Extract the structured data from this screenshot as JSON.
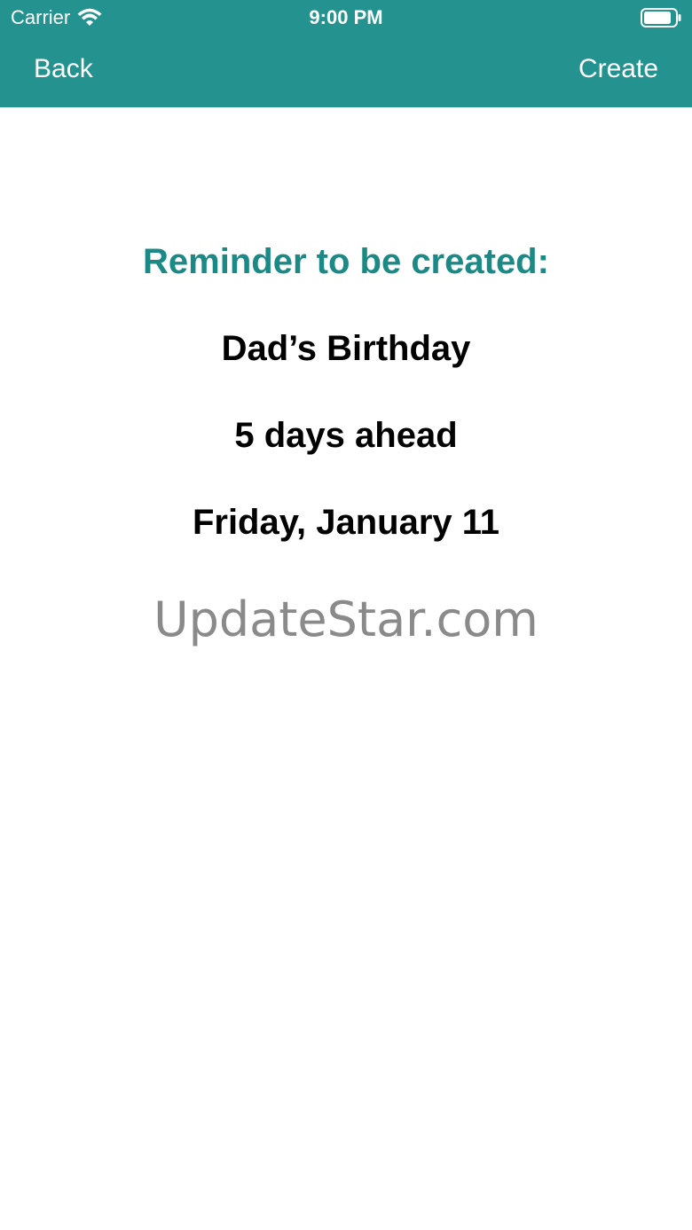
{
  "status_bar": {
    "carrier": "Carrier",
    "time": "9:00 PM",
    "icons": [
      "wifi-icon",
      "battery-icon"
    ]
  },
  "nav": {
    "back_label": "Back",
    "create_label": "Create"
  },
  "reminder": {
    "heading": "Reminder to be created:",
    "name": "Dad’s Birthday",
    "ahead": "5 days ahead",
    "date": "Friday, January 11"
  },
  "watermark": "UpdateStar.com",
  "colors": {
    "accent": "#24938f",
    "heading": "#1b8a86",
    "watermark": "#8a8a8a"
  }
}
